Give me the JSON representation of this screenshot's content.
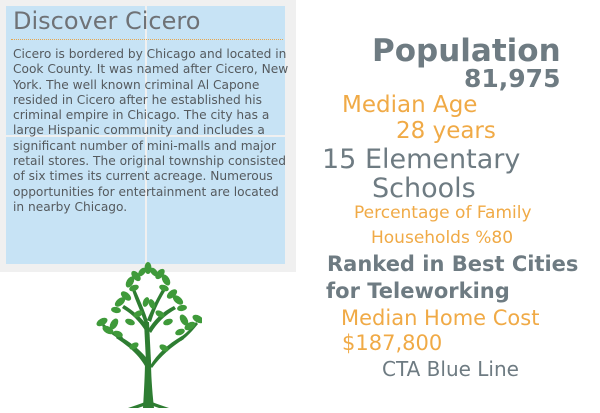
{
  "card": {
    "title": "Discover Cicero",
    "body": "Cicero is bordered by Chicago and located in Cook County. It was named after Cicero, New York. The well known criminal Al Capone resided in Cicero after he established his criminal empire in Chicago. The city has a large Hispanic community and includes a significant number of mini-malls and major retail stores. The original township consisted of six times its current acreage. Numerous opportunities for entertainment are located in nearby Chicago."
  },
  "facts": {
    "population_label": "Population",
    "population_value": "81,975",
    "median_age_label": "Median Age",
    "median_age_value": "28 years",
    "schools_line1": "15 Elementary",
    "schools_line2": "Schools",
    "family_line1": "Percentage of Family",
    "family_line2": "Households %80",
    "ranked_line1": "Ranked in Best Cities",
    "ranked_line2": "for Teleworking",
    "home_cost_label": "Median Home Cost",
    "home_cost_value": "$187,800",
    "transit": "CTA Blue Line"
  },
  "colors": {
    "pane_blue": "#c7e3f5",
    "frame_gray": "#f0f0f0",
    "text_gray": "#6e7b82",
    "accent_orange": "#f0aa46",
    "tree_green": "#2e7d32"
  },
  "icons": {
    "tree": "tree-icon"
  }
}
